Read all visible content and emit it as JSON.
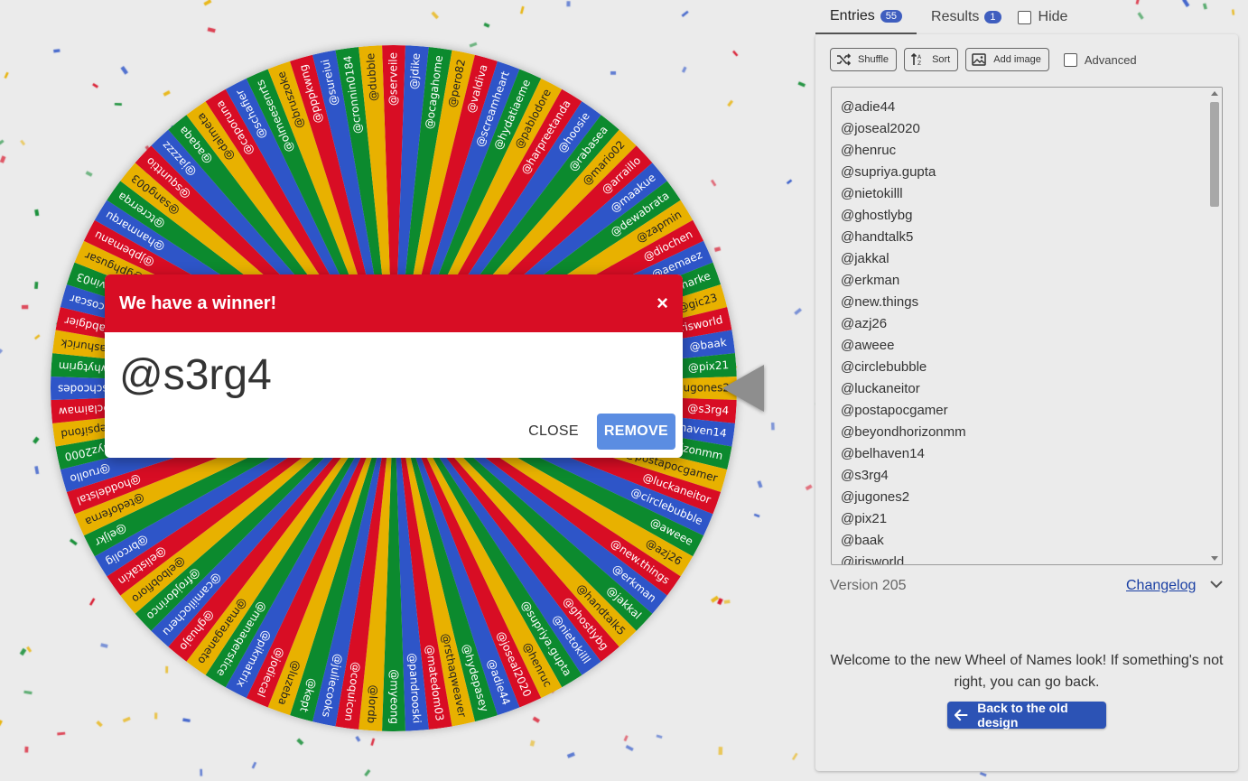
{
  "tabs": {
    "entries_label": "Entries",
    "entries_count": "55",
    "results_label": "Results",
    "results_count": "1",
    "hide_label": "Hide"
  },
  "toolbar": {
    "shuffle_label": "Shuffle",
    "sort_label": "Sort",
    "add_image_label": "Add image",
    "advanced_label": "Advanced"
  },
  "entries": [
    "@adie44",
    "@joseal2020",
    "@henruc",
    "@supriya.gupta",
    "@nietokilll",
    "@ghostlybg",
    "@handtalk5",
    "@jakkal",
    "@erkman",
    "@new.things",
    "@azj26",
    "@aweee",
    "@circlebubble",
    "@luckaneitor",
    "@postapocgamer",
    "@beyondhorizonmm",
    "@belhaven14",
    "@s3rg4",
    "@jugones2",
    "@pix21",
    "@baak",
    "@irisworld"
  ],
  "wheel_labels": [
    "@serveile",
    "@jdike",
    "@ocagahome",
    "@pero82",
    "@valdiva",
    "@screamheart",
    "@hydatiaeme",
    "@pablodore",
    "@harpreetanda",
    "@hoosie",
    "@rabasea",
    "@mario02",
    "@arraillo",
    "@maakue",
    "@dewabrata",
    "@zapmin",
    "@diochen",
    "@aemaez",
    "@harke",
    "@gic23",
    "@irisworld",
    "@baak",
    "@pix21",
    "@jugones2",
    "@s3rg4",
    "@belhaven14",
    "@beyondhorizonmm",
    "@postapocgamer",
    "@luckaneitor",
    "@circlebubble",
    "@aweee",
    "@azj26",
    "@new.things",
    "@erkman",
    "@jakkal",
    "@handtalk5",
    "@ghostlybg",
    "@nietokilll",
    "@supriya.gupta",
    "@henruc",
    "@joseal2020",
    "@adie44",
    "@hydepasey",
    "@rsthaqweaver",
    "@matedom03",
    "@pandrooski",
    "@myeong",
    "@lordb",
    "@coquicon",
    "@juliecooks",
    "@kept",
    "@luzeba",
    "@jodiecal",
    "@pikmatrix",
    "@manaqerstice",
    "@maraganeto",
    "@ghuajo",
    "@camiilocheru",
    "@frojdorinco",
    "@elbobfioro",
    "@elistakin",
    "@brcolig",
    "@eljkr",
    "@tedoferna",
    "@hoddelstal",
    "@ruollo",
    "@lhudyz2000",
    "@lpepsifond",
    "@claimaw",
    "@schcodes",
    "@whytgrim",
    "@tashurick",
    "@fabdgier",
    "@coscar",
    "@tmelvin03",
    "@gphgusar",
    "@jpbemanu",
    "@hanmarqu",
    "@tcrerrqa",
    "@sang003",
    "@squnttio",
    "@jazzzz",
    "@aqaqa",
    "@dalmeta",
    "@caporuna",
    "@schafier",
    "@olmeesenrts",
    "@bruszoke",
    "@pppkwng",
    "@sureiui",
    "@cronnin0184",
    "@dubble"
  ],
  "wheel_colors": [
    "#d80d24",
    "#2e55c8",
    "#0c8a2e",
    "#e8b100"
  ],
  "modal": {
    "title": "We have a winner!",
    "close_x": "×",
    "winner": "@s3rg4",
    "close_label": "CLOSE",
    "remove_label": "REMOVE"
  },
  "footer": {
    "version": "Version 205",
    "changelog": "Changelog",
    "welcome": "Welcome to the new Wheel of Names look! If something's not right, you can go back.",
    "back_label": "Back to the old design"
  },
  "confetti_colors": [
    "#d80d24",
    "#2e55c8",
    "#0c8a2e",
    "#e8b100"
  ]
}
